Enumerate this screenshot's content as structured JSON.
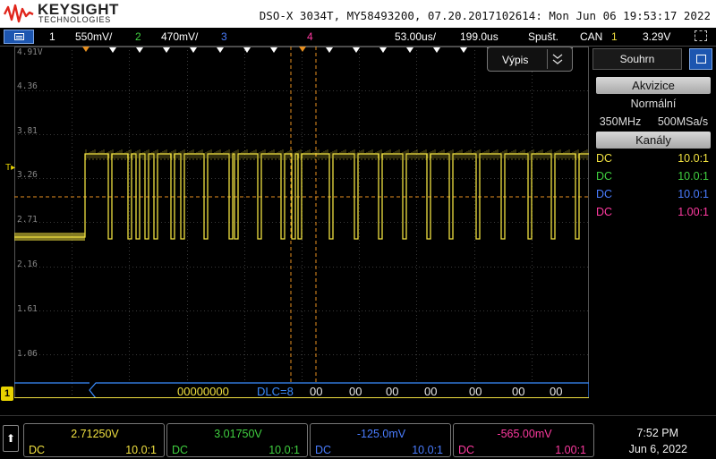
{
  "header": {
    "brand": "KEYSIGHT",
    "brand_sub": "TECHNOLOGIES",
    "device_info": "DSO-X 3034T, MY58493200, 07.20.2017102614: Mon Jun 06 19:53:17 2022"
  },
  "statusbar": {
    "ch1_num": "1",
    "ch1_scale": "550mV/",
    "ch2_num": "2",
    "ch2_scale": "470mV/",
    "ch3_num": "3",
    "ch4_num": "4",
    "timebase": "53.00us/",
    "delay": "199.0us",
    "trigger_mode": "Spušt.",
    "trigger_source": "CAN",
    "trigger_channel": "1",
    "trigger_level": "3.29V"
  },
  "graticule": {
    "voltage_labels": [
      "4.91V",
      "4.36",
      "3.81",
      "3.26",
      "2.71",
      "2.16",
      "1.61",
      "1.06"
    ],
    "trigger_label": "T",
    "ch1_marker": "1",
    "decode_text": "00000000",
    "decode_dlc": "DLC=8",
    "decode_bytes": [
      "00",
      "00",
      "00",
      "00",
      "00",
      "00",
      "00"
    ],
    "vypis_label": "Výpis"
  },
  "side_panel": {
    "summary_tab": "Souhrn",
    "acq_header": "Akvizice",
    "acq_mode": "Normální",
    "acq_bandwidth": "350MHz",
    "acq_rate": "500MSa/s",
    "channels_header": "Kanály",
    "channels": [
      {
        "coupling": "DC",
        "probe": "10.0:1"
      },
      {
        "coupling": "DC",
        "probe": "10.0:1"
      },
      {
        "coupling": "DC",
        "probe": "10.0:1"
      },
      {
        "coupling": "DC",
        "probe": "1.00:1"
      }
    ]
  },
  "bottom_bar": {
    "channels": [
      {
        "value": "2.71250V",
        "coupling": "DC",
        "probe": "10.0:1"
      },
      {
        "value": "3.01750V",
        "coupling": "DC",
        "probe": "10.0:1"
      },
      {
        "value": "-125.0mV",
        "coupling": "DC",
        "probe": "10.0:1"
      },
      {
        "value": "-565.00mV",
        "coupling": "DC",
        "probe": "1.00:1"
      }
    ],
    "time": "7:52 PM",
    "date": "Jun 6, 2022"
  },
  "colors": {
    "ch1": "#f0e040",
    "ch2": "#40d040",
    "ch3": "#4a7dff",
    "ch4": "#ff3aa0",
    "cursor": "#e89020",
    "decode": "#3a8cff",
    "menu_blue": "#1d56b0"
  },
  "icons": [
    "keysight-wave-logo",
    "menu-icon",
    "zoom-icon",
    "up-arrow-icon",
    "chevron-down-icon"
  ]
}
